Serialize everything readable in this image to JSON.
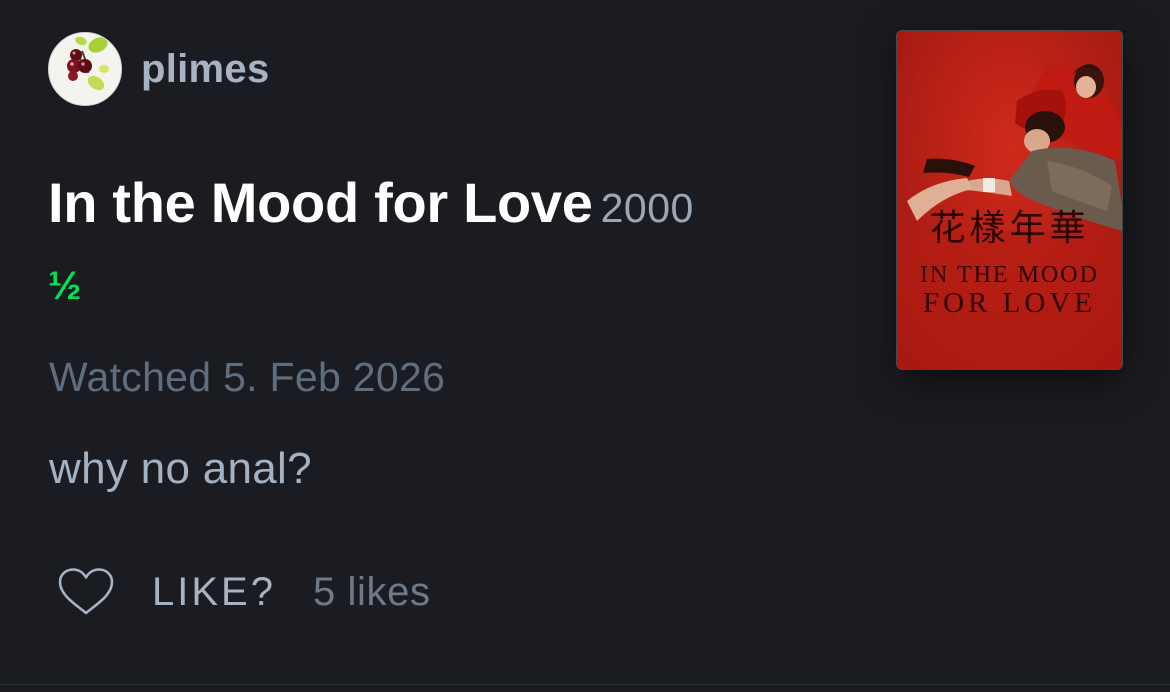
{
  "author": {
    "username": "plimes"
  },
  "film": {
    "title": "In the Mood for Love",
    "year": "2000",
    "poster": {
      "cjk_title": "花樣年華",
      "title_line1": "IN THE MOOD",
      "title_line2": "FOR LOVE"
    }
  },
  "review": {
    "rating": "½",
    "rating_value": 0.5,
    "rating_max": 5,
    "watched_text": "Watched 5. Feb 2026",
    "body": "why no anal?"
  },
  "likes": {
    "action_label": "LIKE?",
    "count_text": "5 likes"
  },
  "colors": {
    "background": "#1a1c21",
    "rating_green": "#00e054",
    "username": "#a7b3c2",
    "muted": "#5f6e7e",
    "poster_red": "#b51d13"
  },
  "icons": {
    "like": "heart-outline-icon",
    "avatar": "cherries-avatar"
  }
}
